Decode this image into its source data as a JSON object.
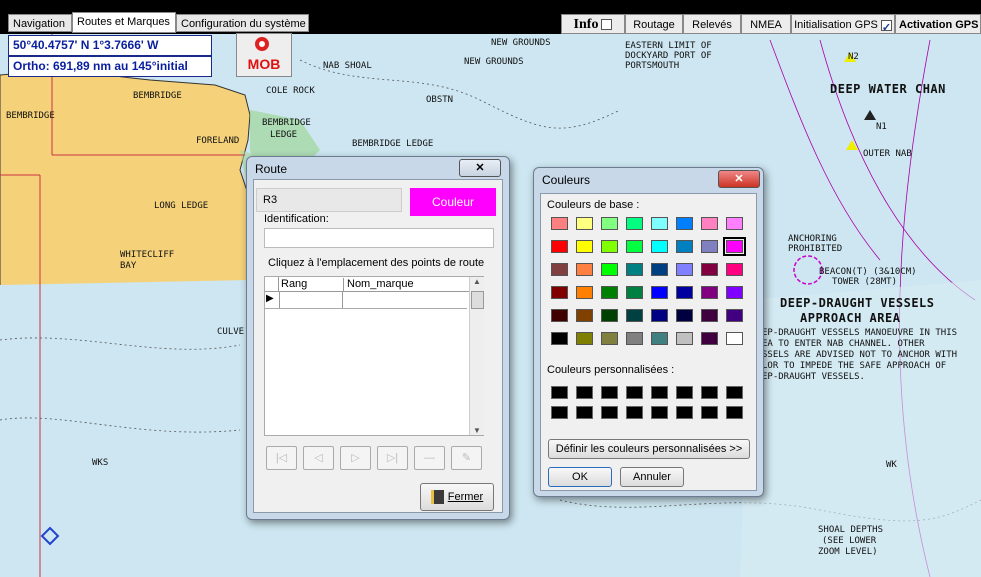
{
  "tabs": [
    {
      "label": "Navigation"
    },
    {
      "label": "Routes et Marques"
    },
    {
      "label": "Configuration du système"
    }
  ],
  "toolbar": {
    "info_label": "Info",
    "routage_label": "Routage",
    "releves_label": "Relevés",
    "nmea_label": "NMEA",
    "init_gps_label": "Initialisation GPS",
    "init_gps_checked": true,
    "activation_gps_label": "Activation GPS"
  },
  "position": {
    "coords": "50°40.4757' N  1°3.7666' W",
    "ortho": "Ortho: 691,89 nm au 145°initial"
  },
  "mob_label": "MOB",
  "map": {
    "labels": {
      "new_grounds": "NEW GROUNDS",
      "new_grounds2": "NEW GROUNDS",
      "eastern_limit": "EASTERN LIMIT OF",
      "dockyard": "DOCKYARD PORT OF",
      "portsmouth": "PORTSMOUTH",
      "nab_shoal": "NAB SHOAL",
      "bembridge": "BEMBRIDGE",
      "bembridge_w": "BEMBRIDGE",
      "cole_rock": "COLE ROCK",
      "obstn": "OBSTN",
      "foreland": "FORELAND",
      "bembridge_ledge": "BEMBRIDGE",
      "bembridge_ledge2": "LEDGE",
      "bembridge_ledge_c": "BEMBRIDGE LEDGE",
      "long_ledge": "LONG LEDGE",
      "whitecliff": "WHITECLIFF",
      "bay": "BAY",
      "culver": "CULVE",
      "deep_water": "DEEP WATER CHAN",
      "outer_nab": "OUTER NAB",
      "anchoring": "ANCHORING",
      "prohibited": "PROHIBITED",
      "beacon": "BEACON(T) (3&10CM)",
      "tower": "TOWER (28MT)",
      "deep_draught": "DEEP-DRAUGHT VESSELS",
      "approach": "APPROACH AREA",
      "note1": "EP-DRAUGHT VESSELS MANOEUVRE IN THIS",
      "note2": "EA TO ENTER NAB CHANNEL. OTHER",
      "note3": "SSELS ARE ADVISED NOT TO ANCHOR WITH",
      "note4": "LOR TO IMPEDE THE SAFE APPROACH OF",
      "note5": "EP-DRAUGHT VESSELS.",
      "shoal1": "SHOAL DEPTHS",
      "shoal2": "(SEE LOWER",
      "shoal3": "ZOOM LEVEL)",
      "wks": "WKS",
      "wk": "WK",
      "n1": "N1",
      "n2": "N2"
    }
  },
  "route_dialog": {
    "title": "Route",
    "route_name": "R3",
    "color_button": "Couleur",
    "color_button_bg": "#ff00ff",
    "identification_label": "Identification:",
    "identification_value": "",
    "instruction": "Cliquez à l'emplacement des points de route",
    "columns": [
      "Rang",
      "Nom_marque"
    ],
    "close_button": "Fermer"
  },
  "color_dialog": {
    "title": "Couleurs",
    "basic_label": "Couleurs de base :",
    "basic_colors": [
      [
        "#ff8080",
        "#ffff80",
        "#80ff80",
        "#00ff80",
        "#80ffff",
        "#0080ff",
        "#ff80c0",
        "#ff80ff"
      ],
      [
        "#ff0000",
        "#ffff00",
        "#80ff00",
        "#00ff40",
        "#00ffff",
        "#0080c0",
        "#8080c0",
        "#ff00ff"
      ],
      [
        "#804040",
        "#ff8040",
        "#00ff00",
        "#008080",
        "#004080",
        "#8080ff",
        "#800040",
        "#ff0080"
      ],
      [
        "#800000",
        "#ff8000",
        "#008000",
        "#008040",
        "#0000ff",
        "#0000a0",
        "#800080",
        "#8000ff"
      ],
      [
        "#400000",
        "#804000",
        "#004000",
        "#004040",
        "#000080",
        "#000040",
        "#400040",
        "#400080"
      ],
      [
        "#000000",
        "#808000",
        "#808040",
        "#808080",
        "#408080",
        "#c0c0c0",
        "#400040",
        "#ffffff"
      ]
    ],
    "selected_color": "#ff00ff",
    "custom_label": "Couleurs personnalisées :",
    "custom_colors": [
      [
        "#000000",
        "#000000",
        "#000000",
        "#000000",
        "#000000",
        "#000000",
        "#000000",
        "#000000"
      ],
      [
        "#000000",
        "#000000",
        "#000000",
        "#000000",
        "#000000",
        "#000000",
        "#000000",
        "#000000"
      ]
    ],
    "define_custom_button": "Définir les couleurs personnalisées >>",
    "ok_button": "OK",
    "cancel_button": "Annuler"
  }
}
